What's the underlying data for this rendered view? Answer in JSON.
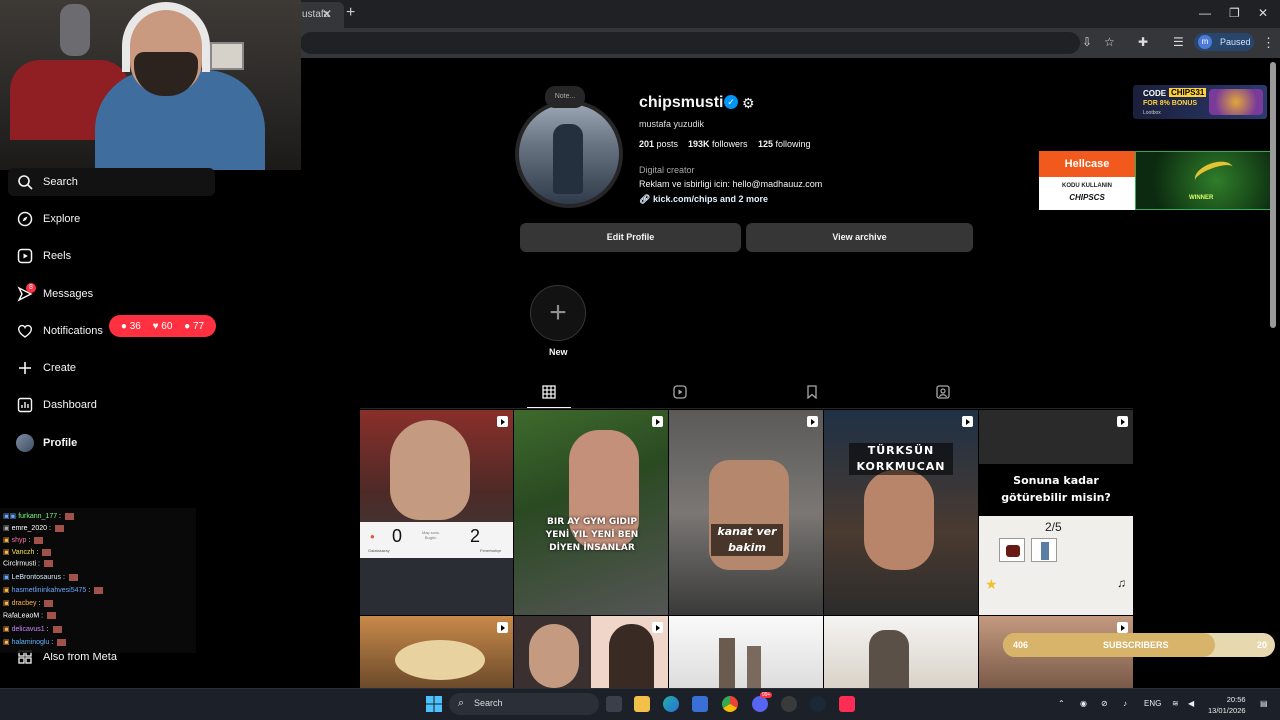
{
  "browser": {
    "tab_title": "ustafa",
    "profile_initial": "m",
    "paused_label": "Paused"
  },
  "sidebar": {
    "items": [
      {
        "label": "Search",
        "icon": "search-icon"
      },
      {
        "label": "Explore",
        "icon": "compass-icon"
      },
      {
        "label": "Reels",
        "icon": "reels-icon"
      },
      {
        "label": "Messages",
        "icon": "messenger-icon",
        "badge": "8"
      },
      {
        "label": "Notifications",
        "icon": "heart-icon"
      },
      {
        "label": "Create",
        "icon": "plus-icon"
      },
      {
        "label": "Dashboard",
        "icon": "chart-icon"
      },
      {
        "label": "Profile",
        "icon": "avatar-icon"
      }
    ],
    "notifications_pill": {
      "comments": "36",
      "likes": "60",
      "follows": "77"
    },
    "also_from_meta": "Also from Meta"
  },
  "chat": {
    "lines": [
      {
        "user": "furkann_177",
        "color": "#7cfc7c"
      },
      {
        "user": "emre_2020",
        "color": "#ffffff"
      },
      {
        "user": "shyp",
        "color": "#ff6fa8"
      },
      {
        "user": "Vanczh",
        "color": "#f3e04a"
      },
      {
        "user": "Circlrmusti",
        "color": "#ffffff"
      },
      {
        "user": "LeBrontosaurus",
        "color": "#d5e8ff"
      },
      {
        "user": "hasmetlininkahvesi5475",
        "color": "#6aa8ff"
      },
      {
        "user": "dracbey",
        "color": "#ffb347"
      },
      {
        "user": "RafaLeaoM",
        "color": "#ffffff"
      },
      {
        "user": "delicavus1",
        "color": "#c78bff"
      },
      {
        "user": "halaminoglu",
        "color": "#5fb3ff"
      }
    ]
  },
  "profile": {
    "note": "Note...",
    "username": "chipsmusti",
    "full_name": "mustafa yuzudik",
    "posts_count": "201",
    "posts_label": "posts",
    "followers_count": "193K",
    "followers_label": "followers",
    "following_count": "125",
    "following_label": "following",
    "category": "Digital creator",
    "bio": "Reklam ve isbirligi icin: hello@madhauuz.com",
    "link": "kick.com/chips and 2 more",
    "edit_button": "Edit Profile",
    "archive_button": "View archive",
    "new_highlight": "New"
  },
  "posts": [
    {
      "caption": "",
      "overlay": "scoreboard",
      "score_left": "0",
      "score_right": "2",
      "team_left": "Galatasaray",
      "team_right": "Fenerbahçe",
      "mid": "Maç sonu\nBugün"
    },
    {
      "caption": "BIR AY GYM GIDIP\nYENİ YIL YENİ BEN\nDİYEN İNSANLAR"
    },
    {
      "caption": "kanat ver\nbakim"
    },
    {
      "caption": "TÜRKSÜN\nKORKMUCAN"
    },
    {
      "caption": "Sonuna kadar\ngötürebilir misin?",
      "quiz": "2/5"
    },
    {
      "caption": ""
    },
    {
      "caption": ""
    },
    {
      "caption": ""
    },
    {
      "caption": ""
    },
    {
      "caption": ""
    }
  ],
  "ads": {
    "ad1": {
      "code_prefix": "CODE",
      "code": "CHIPS31",
      "bonus": "FOR 8% BONUS",
      "brand": "Lootbox"
    },
    "ad2": {
      "brand": "Hellcase",
      "line1": "KODU KULLANIN",
      "code": "CHIPSCS",
      "winner": "WINNER"
    }
  },
  "subscribers": {
    "current": "406",
    "label": "SUBSCRIBERS",
    "goal_step": "20",
    "progress": 0.78
  },
  "taskbar": {
    "search_placeholder": "Search",
    "lang": "ENG",
    "time": "20:56",
    "date": "13/01/2026",
    "discord_badge": "99+"
  },
  "colors": {
    "accent": "#0095f6",
    "notification": "#ff3040",
    "button": "#363636"
  }
}
